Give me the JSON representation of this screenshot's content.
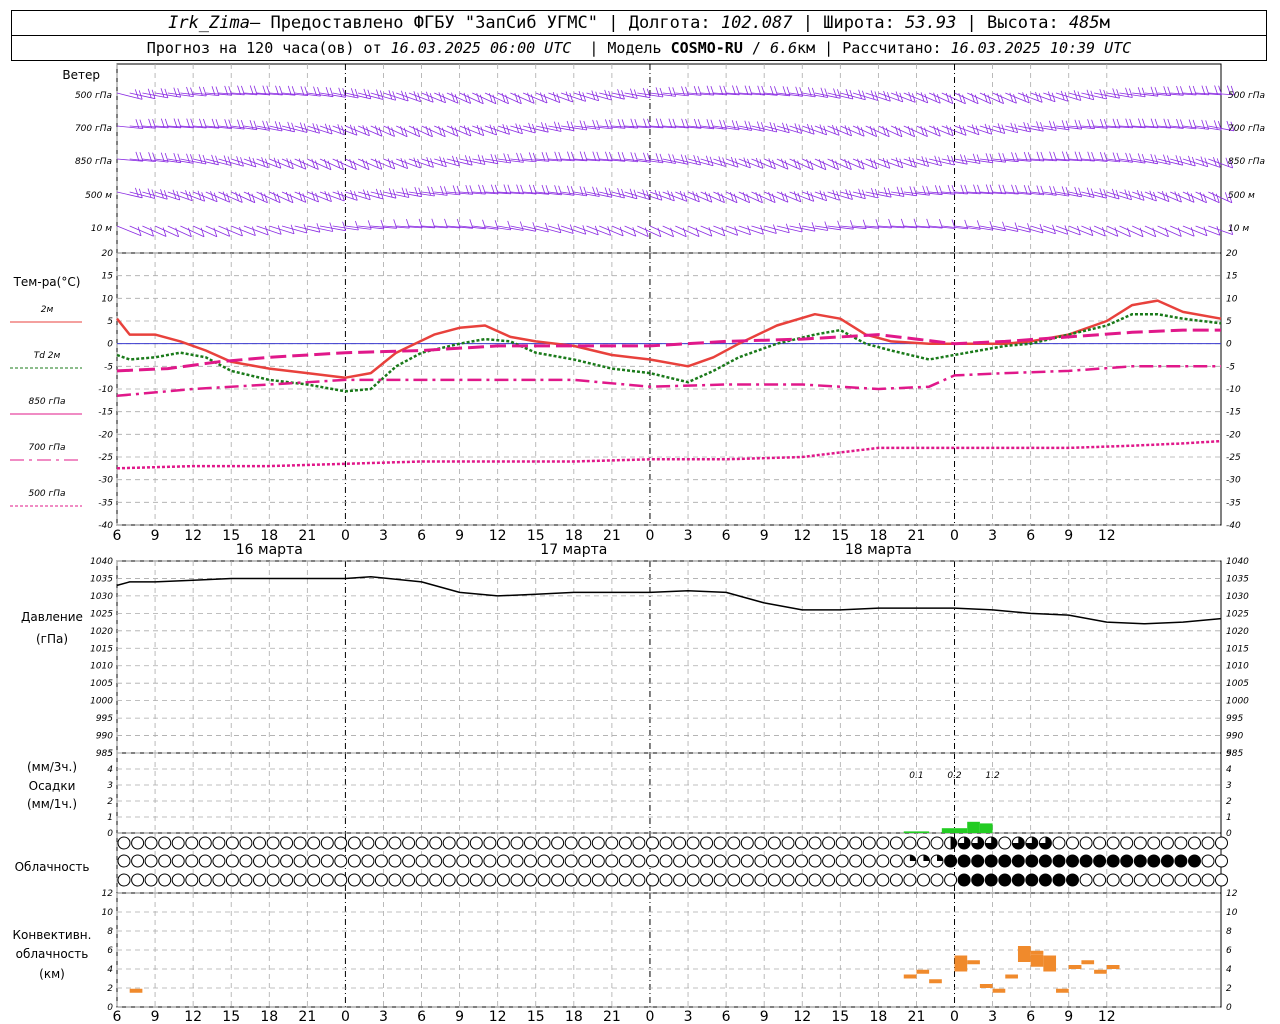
{
  "header": {
    "station": "Irk_Zima",
    "provider": " – Предоставлено ФГБУ \"ЗапСиб УГМС\"",
    "lon_label": "Долгота:",
    "lon": "102.087",
    "lat_label": "Широта:",
    "lat": "53.93",
    "alt_label": "Высота:",
    "alt": "485",
    "alt_unit": "м",
    "forecast_prefix": "Прогноз на 120 часа(ов) от",
    "forecast_start": "16.03.2025 06:00 UTC",
    "model_label": "Модель",
    "model": "COSMO-RU",
    "resolution": "6.6",
    "res_unit": "км",
    "calc_label": "Рассчитано:",
    "calc_time": "16.03.2025 10:39 UTC"
  },
  "wind_panel": {
    "title": "Ветер",
    "levels": [
      "500 гПа",
      "700 гПа",
      "850 гПа",
      "500 м",
      "10 м"
    ],
    "color": "#8a2be2"
  },
  "temp_panel": {
    "title": "Тем-ра(°C)",
    "legend": [
      {
        "label": "2м",
        "color": "#e8413c",
        "dash": "solid"
      },
      {
        "label": "Td 2м",
        "color": "#1a7a1a",
        "dash": "dotted"
      },
      {
        "label": "850 гПа",
        "color": "#e0188a",
        "dash": "solid"
      },
      {
        "label": "700 гПа",
        "color": "#e0188a",
        "dash": "dashdot"
      },
      {
        "label": "500 гПа",
        "color": "#e0188a",
        "dash": "dotted"
      }
    ]
  },
  "pressure_panel": {
    "title": "Давление",
    "unit": "(гПа)"
  },
  "precip_panel": {
    "unit_top": "(мм/3ч.)",
    "title": "Осадки",
    "unit_bottom": "(мм/1ч.)",
    "annotations": [
      {
        "x": 63,
        "text": "0.1"
      },
      {
        "x": 66,
        "text": "0.2"
      },
      {
        "x": 69,
        "text": "1.2"
      }
    ]
  },
  "cloud_panel": {
    "title": "Облачность"
  },
  "conv_panel": {
    "title_1": "Конвективн.",
    "title_2": "облачность",
    "unit": "(км)"
  },
  "dates": [
    {
      "x": 6,
      "label": "16 марта"
    },
    {
      "x": 30,
      "label": "17 марта"
    },
    {
      "x": 54,
      "label": "18 марта"
    }
  ],
  "chart_data": {
    "type": "line",
    "x_unit": "hours since forecast start (16.03.2025 06 UTC)",
    "xlim": [
      0,
      78
    ],
    "x_ticks": [
      0,
      3,
      6,
      9,
      12,
      15,
      18,
      21,
      24,
      27,
      30,
      33,
      36,
      39,
      42,
      45,
      48,
      51,
      54,
      57,
      60,
      63,
      66,
      69,
      72,
      75,
      78
    ],
    "x_tick_labels": [
      "6",
      "9",
      "12",
      "15",
      "18",
      "21",
      "0",
      "3",
      "6",
      "9",
      "12",
      "15",
      "18",
      "21",
      "0",
      "3",
      "6",
      "9",
      "12",
      "15",
      "18",
      "21",
      "0",
      "3",
      "6",
      "9",
      "12"
    ],
    "temperature": {
      "ylim": [
        -40,
        20
      ],
      "y_ticks": [
        20,
        15,
        10,
        5,
        0,
        -5,
        -10,
        -15,
        -20,
        -25,
        -30,
        -35,
        -40
      ],
      "series": [
        {
          "name": "2м",
          "color": "#e8413c",
          "dash": "solid",
          "width": 2.5,
          "points": [
            [
              0,
              5.5
            ],
            [
              1,
              2
            ],
            [
              3,
              2
            ],
            [
              5,
              0.5
            ],
            [
              7,
              -1.5
            ],
            [
              9,
              -4
            ],
            [
              12,
              -5.5
            ],
            [
              15,
              -6.5
            ],
            [
              18,
              -7.5
            ],
            [
              20,
              -6.5
            ],
            [
              22,
              -2
            ],
            [
              25,
              2
            ],
            [
              27,
              3.5
            ],
            [
              29,
              4
            ],
            [
              31,
              1.5
            ],
            [
              33,
              0.5
            ],
            [
              36,
              -0.5
            ],
            [
              39,
              -2.5
            ],
            [
              42,
              -3.5
            ],
            [
              45,
              -5
            ],
            [
              47,
              -3
            ],
            [
              49,
              0
            ],
            [
              52,
              4
            ],
            [
              55,
              6.5
            ],
            [
              57,
              5.5
            ],
            [
              59,
              2
            ],
            [
              61,
              0.5
            ],
            [
              64,
              0
            ],
            [
              67,
              0
            ],
            [
              70,
              0
            ],
            [
              72,
              0.5
            ],
            [
              75,
              2
            ],
            [
              78,
              5
            ],
            [
              80,
              8.5
            ],
            [
              82,
              9.5
            ],
            [
              84,
              7
            ],
            [
              87,
              5.5
            ]
          ]
        },
        {
          "name": "Td 2м",
          "color": "#1a7a1a",
          "dash": "dotted",
          "width": 2.5,
          "points": [
            [
              0,
              -2.5
            ],
            [
              1,
              -3.5
            ],
            [
              3,
              -3
            ],
            [
              5,
              -2
            ],
            [
              7,
              -3
            ],
            [
              9,
              -6
            ],
            [
              12,
              -8
            ],
            [
              15,
              -9
            ],
            [
              18,
              -10.5
            ],
            [
              20,
              -10
            ],
            [
              22,
              -5
            ],
            [
              24,
              -2
            ],
            [
              27,
              0
            ],
            [
              29,
              1
            ],
            [
              31,
              0.5
            ],
            [
              33,
              -2
            ],
            [
              36,
              -3.5
            ],
            [
              39,
              -5.5
            ],
            [
              42,
              -6.5
            ],
            [
              45,
              -8.5
            ],
            [
              47,
              -6
            ],
            [
              49,
              -3
            ],
            [
              52,
              0
            ],
            [
              55,
              2
            ],
            [
              57,
              3
            ],
            [
              59,
              0
            ],
            [
              61,
              -1.5
            ],
            [
              64,
              -3.5
            ],
            [
              67,
              -2
            ],
            [
              70,
              -0.5
            ],
            [
              72,
              0
            ],
            [
              75,
              2
            ],
            [
              78,
              4
            ],
            [
              80,
              6.5
            ],
            [
              82,
              6.5
            ],
            [
              84,
              5.5
            ],
            [
              87,
              4.5
            ]
          ]
        },
        {
          "name": "850 гПа",
          "color": "#e0188a",
          "dash": "longdash",
          "width": 3,
          "points": [
            [
              0,
              -6
            ],
            [
              4,
              -5.5
            ],
            [
              8,
              -4
            ],
            [
              12,
              -3
            ],
            [
              18,
              -2
            ],
            [
              24,
              -1.5
            ],
            [
              30,
              -0.5
            ],
            [
              36,
              -0.5
            ],
            [
              42,
              -0.5
            ],
            [
              48,
              0.5
            ],
            [
              54,
              1
            ],
            [
              57,
              1.5
            ],
            [
              60,
              2
            ],
            [
              63,
              1
            ],
            [
              66,
              0
            ],
            [
              70,
              0.5
            ],
            [
              75,
              1.5
            ],
            [
              80,
              2.5
            ],
            [
              84,
              3
            ],
            [
              87,
              3
            ]
          ]
        },
        {
          "name": "700 гПа",
          "color": "#e0188a",
          "dash": "dashdot",
          "width": 2.5,
          "points": [
            [
              0,
              -11.5
            ],
            [
              6,
              -10
            ],
            [
              12,
              -9
            ],
            [
              18,
              -8
            ],
            [
              24,
              -8
            ],
            [
              30,
              -8
            ],
            [
              36,
              -8
            ],
            [
              42,
              -9.5
            ],
            [
              48,
              -9
            ],
            [
              54,
              -9
            ],
            [
              60,
              -10
            ],
            [
              64,
              -9.5
            ],
            [
              66,
              -7
            ],
            [
              70,
              -6.5
            ],
            [
              75,
              -6
            ],
            [
              80,
              -5
            ],
            [
              87,
              -5
            ]
          ]
        },
        {
          "name": "500 гПа",
          "color": "#e0188a",
          "dash": "dotted",
          "width": 2.5,
          "points": [
            [
              0,
              -27.5
            ],
            [
              6,
              -27
            ],
            [
              12,
              -27
            ],
            [
              18,
              -26.5
            ],
            [
              24,
              -26
            ],
            [
              30,
              -26
            ],
            [
              36,
              -26
            ],
            [
              42,
              -25.5
            ],
            [
              48,
              -25.5
            ],
            [
              54,
              -25
            ],
            [
              60,
              -23
            ],
            [
              64,
              -23
            ],
            [
              66,
              -23
            ],
            [
              70,
              -23
            ],
            [
              75,
              -23
            ],
            [
              80,
              -22.5
            ],
            [
              84,
              -22
            ],
            [
              87,
              -21.5
            ]
          ]
        }
      ]
    },
    "pressure": {
      "ylim": [
        985,
        1040
      ],
      "y_ticks": [
        1040,
        1035,
        1030,
        1025,
        1020,
        1015,
        1010,
        1005,
        1000,
        995,
        990,
        985
      ],
      "series": [
        {
          "name": "",
          "color": "#000000",
          "dash": "solid",
          "width": 1.5,
          "points": [
            [
              0,
              1033
            ],
            [
              1,
              1034
            ],
            [
              3,
              1034
            ],
            [
              6,
              1034.5
            ],
            [
              9,
              1035
            ],
            [
              12,
              1035
            ],
            [
              15,
              1035
            ],
            [
              18,
              1035
            ],
            [
              20,
              1035.5
            ],
            [
              24,
              1034
            ],
            [
              27,
              1031
            ],
            [
              30,
              1030
            ],
            [
              33,
              1030.5
            ],
            [
              36,
              1031
            ],
            [
              39,
              1031
            ],
            [
              42,
              1031
            ],
            [
              45,
              1031.5
            ],
            [
              48,
              1031
            ],
            [
              51,
              1028
            ],
            [
              54,
              1026
            ],
            [
              57,
              1026
            ],
            [
              60,
              1026.5
            ],
            [
              63,
              1026.5
            ],
            [
              66,
              1026.5
            ],
            [
              69,
              1026
            ],
            [
              72,
              1025
            ],
            [
              75,
              1024.5
            ],
            [
              78,
              1022.5
            ],
            [
              81,
              1022
            ],
            [
              84,
              1022.5
            ],
            [
              87,
              1023.5
            ]
          ]
        }
      ]
    },
    "precip": {
      "ylim": [
        0,
        5
      ],
      "y_ticks": [
        5,
        4,
        3,
        2,
        1,
        0
      ],
      "bars": [
        [
          62,
          0.1
        ],
        [
          63,
          0.1
        ],
        [
          65,
          0.3
        ],
        [
          66,
          0.3
        ],
        [
          67,
          0.7
        ],
        [
          68,
          0.6
        ]
      ]
    },
    "convective": {
      "ylim": [
        0,
        12
      ],
      "y_ticks": [
        12,
        10,
        8,
        6,
        4,
        2,
        0
      ],
      "bars": [
        [
          1,
          1.5
        ],
        [
          62,
          3
        ],
        [
          63,
          3.5
        ],
        [
          64,
          2.5
        ],
        [
          66,
          5
        ],
        [
          67,
          4.5
        ],
        [
          68,
          2
        ],
        [
          69,
          1.5
        ],
        [
          70,
          3
        ],
        [
          71,
          6
        ],
        [
          72,
          5.5
        ],
        [
          73,
          5
        ],
        [
          74,
          1.5
        ],
        [
          75,
          4
        ],
        [
          76,
          4.5
        ],
        [
          77,
          3.5
        ],
        [
          78,
          4
        ]
      ]
    }
  }
}
